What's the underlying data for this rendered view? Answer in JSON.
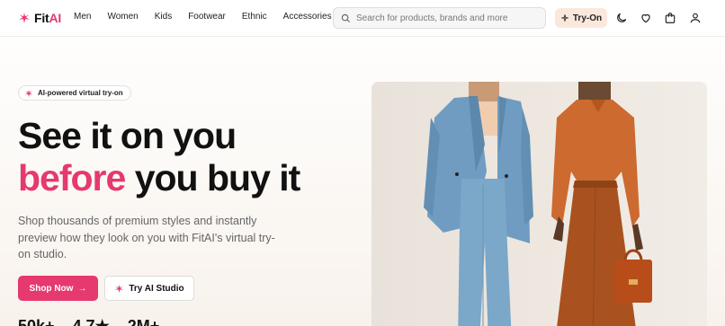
{
  "brand": {
    "name_part1": "Fit",
    "name_part2": "AI"
  },
  "nav": [
    "Men",
    "Women",
    "Kids",
    "Footwear",
    "Ethnic",
    "Accessories"
  ],
  "search": {
    "placeholder": "Search for products, brands and more"
  },
  "header_actions": {
    "tryon_label": "Try-On",
    "icons": [
      "moon-icon",
      "heart-icon",
      "bag-icon",
      "user-icon"
    ]
  },
  "hero": {
    "badge": "AI-powered virtual try-on",
    "headline_line1": "See it on you",
    "headline_highlight": "before",
    "headline_rest": " you buy it",
    "description": "Shop thousands of premium styles and instantly preview how they look on you with FitAI's virtual try-on studio.",
    "primary_button": "Shop Now",
    "secondary_button": "Try AI Studio",
    "stats": [
      "50k+",
      "4.7★",
      "2M+"
    ]
  },
  "colors": {
    "accent": "#e5396f",
    "tryon_bg": "#fbe8dc"
  }
}
